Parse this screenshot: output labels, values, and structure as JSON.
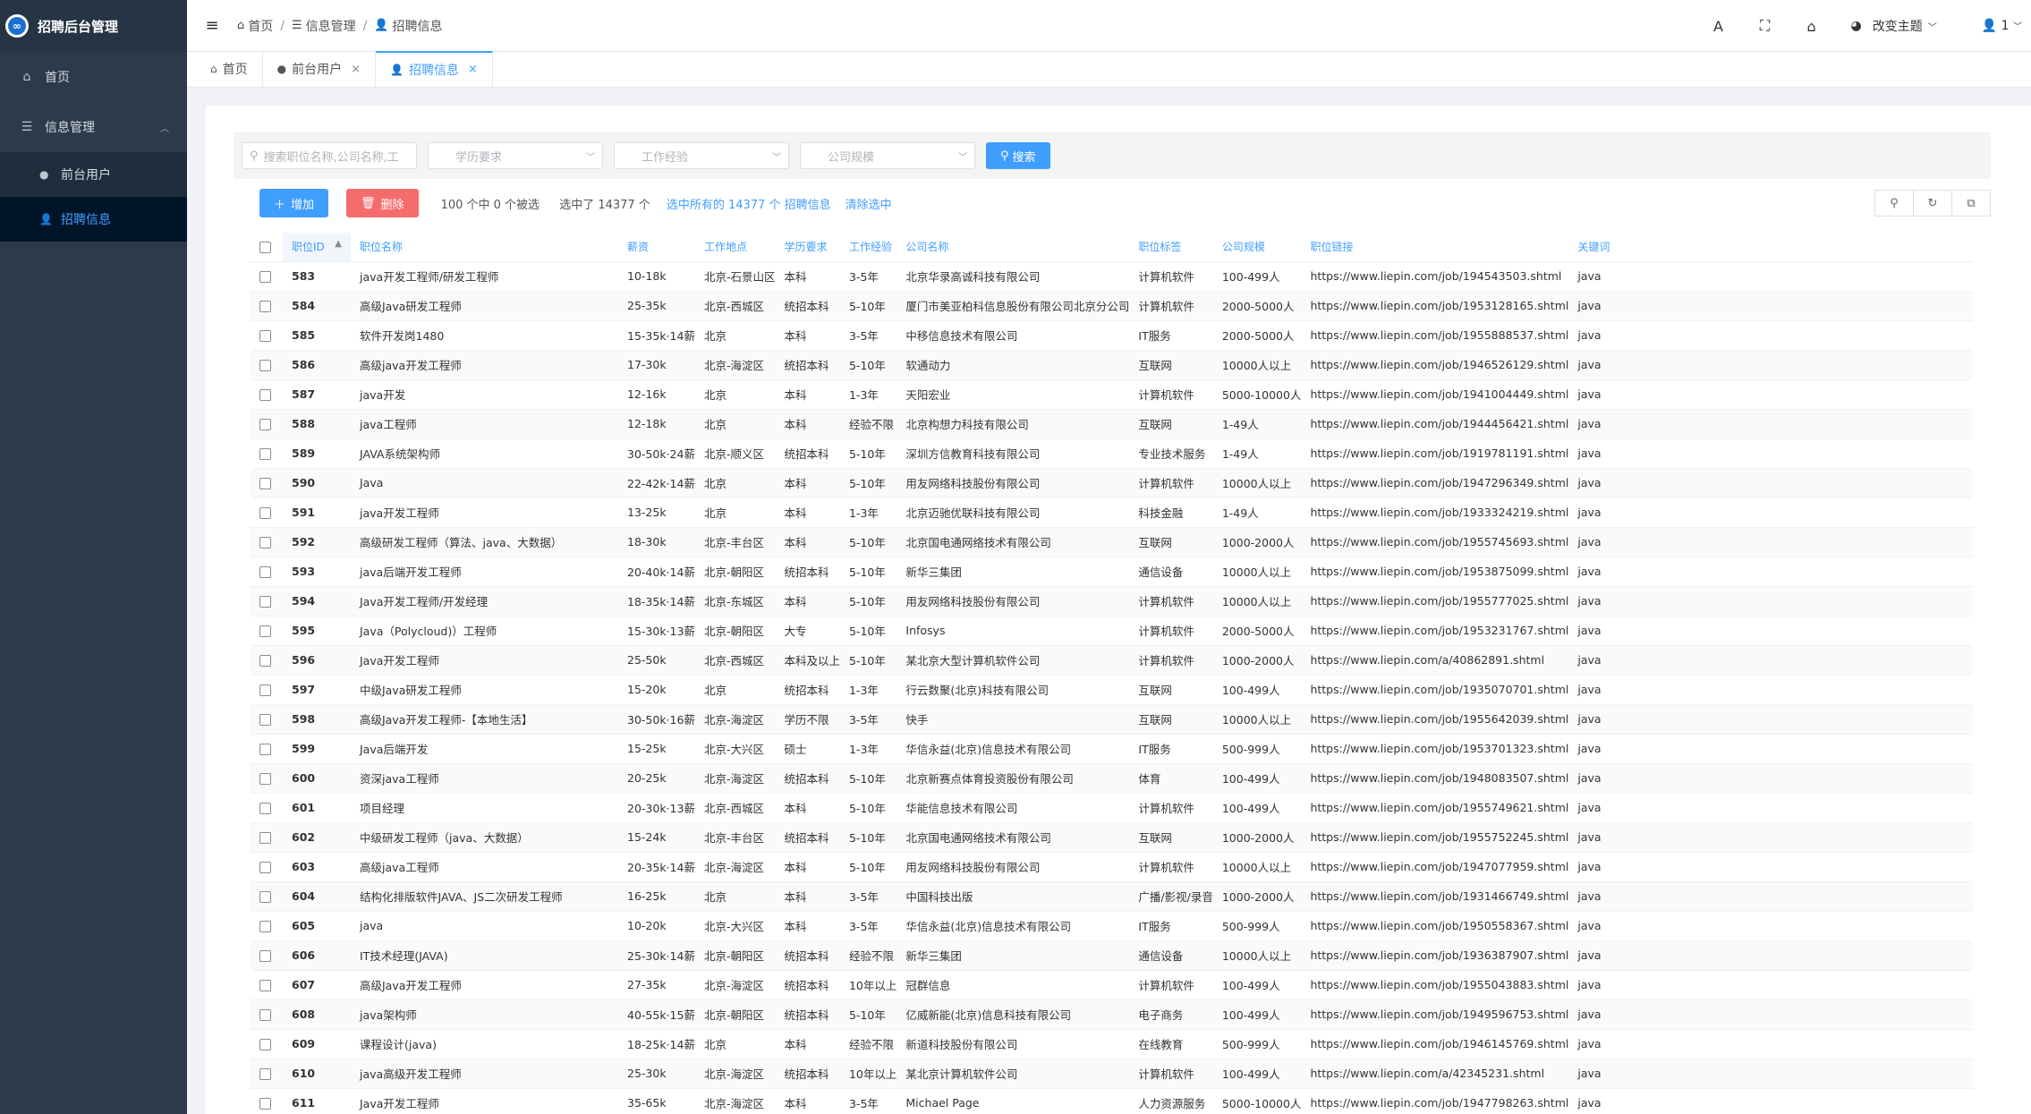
{
  "app": {
    "title": "招聘后台管理",
    "logo_glyph": "∞"
  },
  "sidebar": {
    "home": "首页",
    "group": "信息管理",
    "items": [
      {
        "label": "前台用户"
      },
      {
        "label": "招聘信息"
      }
    ]
  },
  "header": {
    "breadcrumb": [
      "首页",
      "信息管理",
      "招聘信息"
    ],
    "theme_label": "改变主题",
    "user_label": "1"
  },
  "tabs": [
    {
      "label": "首页"
    },
    {
      "label": "前台用户"
    },
    {
      "label": "招聘信息"
    }
  ],
  "filters": {
    "search_placeholder": "搜索职位名称,公司名称,工",
    "education": "学历要求",
    "experience": "工作经验",
    "company_size": "公司规模",
    "search_button": "搜索"
  },
  "toolbar": {
    "add": "增加",
    "delete": "删除",
    "page_selected": "100 个中 0 个被选",
    "selected_total": "选中了 14377 个",
    "select_all": "选中所有的 14377 个 招聘信息",
    "clear": "清除选中"
  },
  "table": {
    "headers": [
      "职位ID",
      "职位名称",
      "薪资",
      "工作地点",
      "学历要求",
      "工作经验",
      "公司名称",
      "职位标签",
      "公司规模",
      "职位链接",
      "关键词"
    ],
    "rows": [
      [
        "583",
        "java开发工程师/研发工程师",
        "10-18k",
        "北京-石景山区",
        "本科",
        "3-5年",
        "北京华录高诚科技有限公司",
        "计算机软件",
        "100-499人",
        "https://www.liepin.com/job/194543503.shtml",
        "java"
      ],
      [
        "584",
        "高级Java研发工程师",
        "25-35k",
        "北京-西城区",
        "统招本科",
        "5-10年",
        "厦门市美亚柏科信息股份有限公司北京分公司",
        "计算机软件",
        "2000-5000人",
        "https://www.liepin.com/job/1953128165.shtml",
        "java"
      ],
      [
        "585",
        "软件开发岗1480",
        "15-35k·14薪",
        "北京",
        "本科",
        "3-5年",
        "中移信息技术有限公司",
        "IT服务",
        "2000-5000人",
        "https://www.liepin.com/job/1955888537.shtml",
        "java"
      ],
      [
        "586",
        "高级java开发工程师",
        "17-30k",
        "北京-海淀区",
        "统招本科",
        "5-10年",
        "软通动力",
        "互联网",
        "10000人以上",
        "https://www.liepin.com/job/1946526129.shtml",
        "java"
      ],
      [
        "587",
        "java开发",
        "12-16k",
        "北京",
        "本科",
        "1-3年",
        "天阳宏业",
        "计算机软件",
        "5000-10000人",
        "https://www.liepin.com/job/1941004449.shtml",
        "java"
      ],
      [
        "588",
        "java工程师",
        "12-18k",
        "北京",
        "本科",
        "经验不限",
        "北京构想力科技有限公司",
        "互联网",
        "1-49人",
        "https://www.liepin.com/job/1944456421.shtml",
        "java"
      ],
      [
        "589",
        "JAVA系统架构师",
        "30-50k·24薪",
        "北京-顺义区",
        "统招本科",
        "5-10年",
        "深圳方信教育科技有限公司",
        "专业技术服务",
        "1-49人",
        "https://www.liepin.com/job/1919781191.shtml",
        "java"
      ],
      [
        "590",
        "Java",
        "22-42k·14薪",
        "北京",
        "本科",
        "5-10年",
        "用友网络科技股份有限公司",
        "计算机软件",
        "10000人以上",
        "https://www.liepin.com/job/1947296349.shtml",
        "java"
      ],
      [
        "591",
        "java开发工程师",
        "13-25k",
        "北京",
        "本科",
        "1-3年",
        "北京迈驰优联科技有限公司",
        "科技金融",
        "1-49人",
        "https://www.liepin.com/job/1933324219.shtml",
        "java"
      ],
      [
        "592",
        "高级研发工程师（算法、java、大数据）",
        "18-30k",
        "北京-丰台区",
        "本科",
        "5-10年",
        "北京国电通网络技术有限公司",
        "互联网",
        "1000-2000人",
        "https://www.liepin.com/job/1955745693.shtml",
        "java"
      ],
      [
        "593",
        "java后端开发工程师",
        "20-40k·14薪",
        "北京-朝阳区",
        "统招本科",
        "5-10年",
        "新华三集团",
        "通信设备",
        "10000人以上",
        "https://www.liepin.com/job/1953875099.shtml",
        "java"
      ],
      [
        "594",
        "Java开发工程师/开发经理",
        "18-35k·14薪",
        "北京-东城区",
        "本科",
        "5-10年",
        "用友网络科技股份有限公司",
        "计算机软件",
        "10000人以上",
        "https://www.liepin.com/job/1955777025.shtml",
        "java"
      ],
      [
        "595",
        "Java（Polycloud)）工程师",
        "15-30k·13薪",
        "北京-朝阳区",
        "大专",
        "5-10年",
        "Infosys",
        "计算机软件",
        "2000-5000人",
        "https://www.liepin.com/job/1953231767.shtml",
        "java"
      ],
      [
        "596",
        "Java开发工程师",
        "25-50k",
        "北京-西城区",
        "本科及以上",
        "5-10年",
        "某北京大型计算机软件公司",
        "计算机软件",
        "1000-2000人",
        "https://www.liepin.com/a/40862891.shtml",
        "java"
      ],
      [
        "597",
        "中级Java研发工程师",
        "15-20k",
        "北京",
        "统招本科",
        "1-3年",
        "行云数聚(北京)科技有限公司",
        "互联网",
        "100-499人",
        "https://www.liepin.com/job/1935070701.shtml",
        "java"
      ],
      [
        "598",
        "高级Java开发工程师-【本地生活】",
        "30-50k·16薪",
        "北京-海淀区",
        "学历不限",
        "3-5年",
        "快手",
        "互联网",
        "10000人以上",
        "https://www.liepin.com/job/1955642039.shtml",
        "java"
      ],
      [
        "599",
        "Java后端开发",
        "15-25k",
        "北京-大兴区",
        "硕士",
        "1-3年",
        "华信永益(北京)信息技术有限公司",
        "IT服务",
        "500-999人",
        "https://www.liepin.com/job/1953701323.shtml",
        "java"
      ],
      [
        "600",
        "资深java工程师",
        "20-25k",
        "北京-海淀区",
        "统招本科",
        "5-10年",
        "北京新赛点体育投资股份有限公司",
        "体育",
        "100-499人",
        "https://www.liepin.com/job/1948083507.shtml",
        "java"
      ],
      [
        "601",
        "项目经理",
        "20-30k·13薪",
        "北京-西城区",
        "本科",
        "5-10年",
        "华能信息技术有限公司",
        "计算机软件",
        "100-499人",
        "https://www.liepin.com/job/1955749621.shtml",
        "java"
      ],
      [
        "602",
        "中级研发工程师（java、大数据）",
        "15-24k",
        "北京-丰台区",
        "统招本科",
        "5-10年",
        "北京国电通网络技术有限公司",
        "互联网",
        "1000-2000人",
        "https://www.liepin.com/job/1955752245.shtml",
        "java"
      ],
      [
        "603",
        "高级java工程师",
        "20-35k·14薪",
        "北京-海淀区",
        "本科",
        "5-10年",
        "用友网络科技股份有限公司",
        "计算机软件",
        "10000人以上",
        "https://www.liepin.com/job/1947077959.shtml",
        "java"
      ],
      [
        "604",
        "结构化排版软件JAVA、JS二次研发工程师",
        "16-25k",
        "北京",
        "本科",
        "3-5年",
        "中国科技出版",
        "广播/影视/录音",
        "1000-2000人",
        "https://www.liepin.com/job/1931466749.shtml",
        "java"
      ],
      [
        "605",
        "java",
        "10-20k",
        "北京-大兴区",
        "本科",
        "3-5年",
        "华信永益(北京)信息技术有限公司",
        "IT服务",
        "500-999人",
        "https://www.liepin.com/job/1950558367.shtml",
        "java"
      ],
      [
        "606",
        "IT技术经理(JAVA)",
        "25-30k·14薪",
        "北京-朝阳区",
        "统招本科",
        "经验不限",
        "新华三集团",
        "通信设备",
        "10000人以上",
        "https://www.liepin.com/job/1936387907.shtml",
        "java"
      ],
      [
        "607",
        "高级Java开发工程师",
        "27-35k",
        "北京-海淀区",
        "统招本科",
        "10年以上",
        "冠群信息",
        "计算机软件",
        "100-499人",
        "https://www.liepin.com/job/1955043883.shtml",
        "java"
      ],
      [
        "608",
        "java架构师",
        "40-55k·15薪",
        "北京-朝阳区",
        "统招本科",
        "5-10年",
        "亿威新能(北京)信息科技有限公司",
        "电子商务",
        "100-499人",
        "https://www.liepin.com/job/1949596753.shtml",
        "java"
      ],
      [
        "609",
        "课程设计(java)",
        "18-25k·14薪",
        "北京",
        "本科",
        "经验不限",
        "新道科技股份有限公司",
        "在线教育",
        "500-999人",
        "https://www.liepin.com/job/1946145769.shtml",
        "java"
      ],
      [
        "610",
        "java高级开发工程师",
        "25-30k",
        "北京-海淀区",
        "统招本科",
        "10年以上",
        "某北京计算机软件公司",
        "计算机软件",
        "100-499人",
        "https://www.liepin.com/a/42345231.shtml",
        "java"
      ],
      [
        "611",
        "Java开发工程师",
        "35-65k",
        "北京-海淀区",
        "本科",
        "3-5年",
        "Michael Page",
        "人力资源服务",
        "5000-10000人",
        "https://www.liepin.com/job/1947798263.shtml",
        "java"
      ]
    ]
  }
}
